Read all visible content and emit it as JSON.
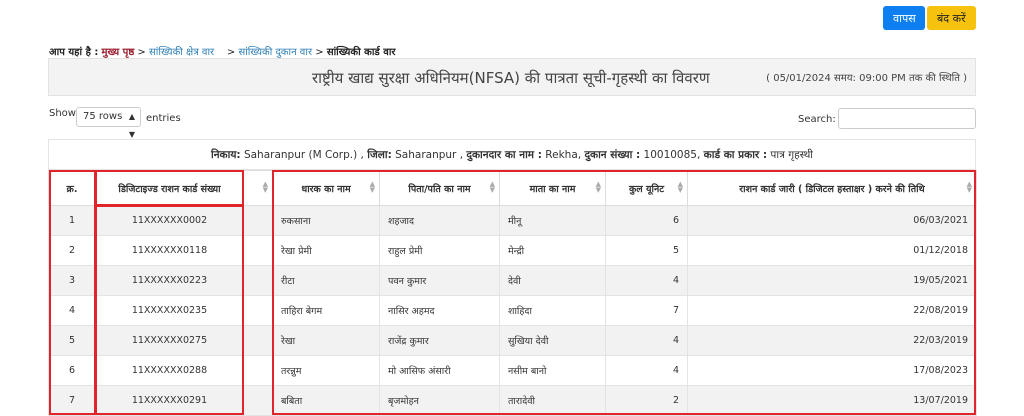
{
  "buttons": {
    "back": "वापस",
    "close": "बंद करें"
  },
  "breadcrumb": {
    "prefix": "आप यहां है :",
    "home": "मुख्य पृष्ठ",
    "sep1": ">",
    "level1": "सांख्यिकी क्षेत्र वार",
    "sep2": ">",
    "level2": "सांख्यिकी दुकान वार",
    "sep3": ">",
    "current": "सांख्यिकी कार्ड वार"
  },
  "title": "राष्ट्रीय खाद्य सुरक्षा अधिनियम(NFSA) की पात्रता सूची-गृहस्थी का विवरण",
  "status": "( 05/01/2024 समय: 09:00 PM तक की स्थिति )",
  "controls": {
    "show": "Show",
    "rows": "75 rows",
    "entries": "entries",
    "search": "Search:"
  },
  "info": {
    "nikay_label": "निकाय:",
    "nikay": "Saharanpur (M Corp.) ,",
    "district_label": "जिला:",
    "district": "Saharanpur ,",
    "dealer_label": "दुकानदार का नाम :",
    "dealer": "Rekha,",
    "shop_label": "दुकान संख्या :",
    "shop": "10010085,",
    "card_type_label": "कार्ड का प्रकार :",
    "card_type": "पात्र गृहस्थी"
  },
  "table": {
    "headers": {
      "sno": "क्र.",
      "card": "डिजिटाइज्ड राशन कार्ड संख्या",
      "holder": "धारक का नाम",
      "father": "पिता/पति का नाम",
      "mother": "माता का नाम",
      "units": "कुल यूनिट",
      "date": "राशन कार्ड जारी ( डिजिटल हस्ताक्षर ) करने की तिथि"
    },
    "rows": [
      {
        "sno": "1",
        "card": "11XXXXXX0002",
        "holder": "रुकसाना",
        "father": "शहजाद",
        "mother": "मीनू",
        "units": "6",
        "date": "06/03/2021"
      },
      {
        "sno": "2",
        "card": "11XXXXXX0118",
        "holder": "रेखा प्रेमी",
        "father": "राहुल प्रेमी",
        "mother": "मेन्द्री",
        "units": "5",
        "date": "01/12/2018"
      },
      {
        "sno": "3",
        "card": "11XXXXXX0223",
        "holder": "रीटा",
        "father": "पवन कुमार",
        "mother": "देवी",
        "units": "4",
        "date": "19/05/2021"
      },
      {
        "sno": "4",
        "card": "11XXXXXX0235",
        "holder": "ताहिरा बेगम",
        "father": "नासिर अहमद",
        "mother": "शाहिदा",
        "units": "7",
        "date": "22/08/2019"
      },
      {
        "sno": "5",
        "card": "11XXXXXX0275",
        "holder": "रेखा",
        "father": "राजेंद्र कुमार",
        "mother": "सुखिया देवी",
        "units": "4",
        "date": "22/03/2019"
      },
      {
        "sno": "6",
        "card": "11XXXXXX0288",
        "holder": "तरन्नुम",
        "father": "मो आसिफ अंसारी",
        "mother": "नसीम बानो",
        "units": "4",
        "date": "17/08/2023"
      },
      {
        "sno": "7",
        "card": "11XXXXXX0291",
        "holder": "बबिता",
        "father": "बृजमोहन",
        "mother": "तारादेवी",
        "units": "2",
        "date": "13/07/2019"
      }
    ]
  }
}
